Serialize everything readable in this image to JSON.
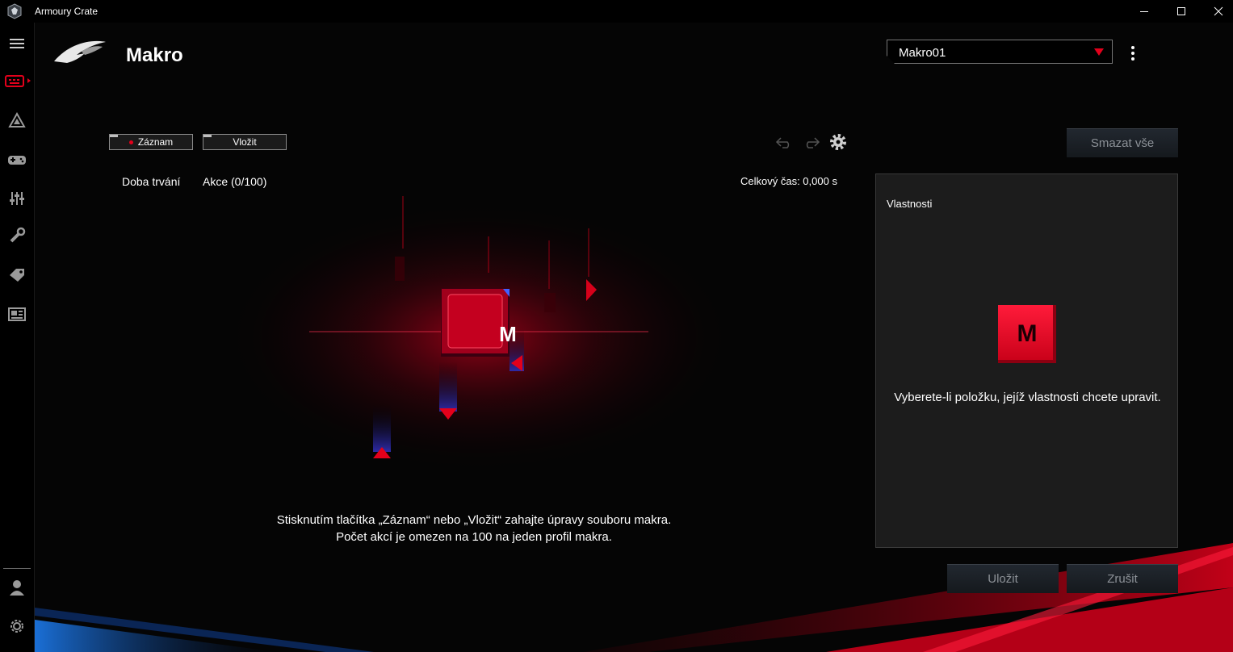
{
  "window": {
    "title": "Armoury Crate",
    "controls": [
      "minimize",
      "maximize",
      "close"
    ]
  },
  "sidebar": {
    "items": [
      {
        "icon": "hamburger-menu-icon",
        "active": false
      },
      {
        "icon": "keyboard-icon",
        "active": true
      },
      {
        "icon": "aura-triangle-icon",
        "active": false
      },
      {
        "icon": "gamepad-icon",
        "active": false
      },
      {
        "icon": "sliders-icon",
        "active": false
      },
      {
        "icon": "wrench-icon",
        "active": false
      },
      {
        "icon": "tag-icon",
        "active": false
      },
      {
        "icon": "news-icon",
        "active": false
      },
      {
        "icon": "user-icon",
        "active": false
      },
      {
        "icon": "settings-gear-icon",
        "active": false
      }
    ]
  },
  "header": {
    "title": "Makro",
    "profile_select": {
      "value": "Makro01"
    }
  },
  "toolbar": {
    "record_label": "Záznam",
    "insert_label": "Vložit",
    "delete_all_label": "Smazat vše",
    "undo_icon": "undo-icon",
    "redo_icon": "redo-icon",
    "settings_icon": "gear-icon"
  },
  "list": {
    "duration_header": "Doba trvání",
    "actions_header": "Akce (0/100)",
    "total_time": "Celkový čas: 0,000 s"
  },
  "main": {
    "key_letter": "M",
    "hint_line1": "Stisknutím tlačítka „Záznam“ nebo „Vložit“ zahajte úpravy souboru makra.",
    "hint_line2": "Počet akcí je omezen na 100 na jeden profil makra."
  },
  "properties": {
    "title": "Vlastnosti",
    "key_letter": "M",
    "hint": "Vyberete-li položku, jejíž vlastnosti chcete upravit."
  },
  "footer": {
    "save_label": "Uložit",
    "cancel_label": "Zrušit"
  },
  "colors": {
    "accent_red": "#e3001b",
    "background": "#000000",
    "panel": "#1c1c1c",
    "disabled_text": "#8c9197"
  }
}
